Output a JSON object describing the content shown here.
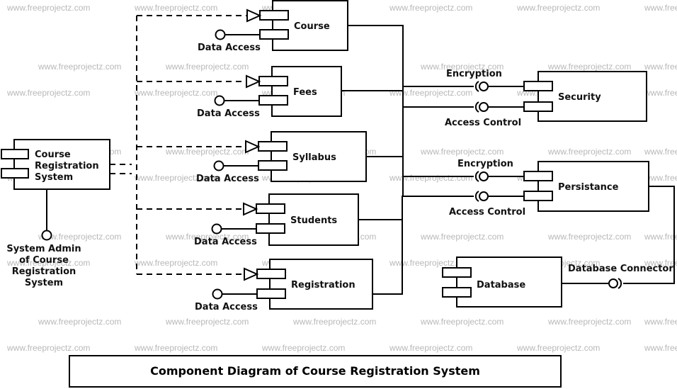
{
  "watermark": "www.freeprojectz.com",
  "title": "Component Diagram of Course Registration System",
  "main_component": {
    "label_lines": [
      "Course",
      "Registration",
      "System"
    ],
    "interface_lines": [
      "System Admin",
      "of Course",
      "Registration",
      "System"
    ]
  },
  "modules": [
    {
      "name": "Course",
      "interface": "Data Access"
    },
    {
      "name": "Fees",
      "interface": "Data Access"
    },
    {
      "name": "Syllabus",
      "interface": "Data Access"
    },
    {
      "name": "Students",
      "interface": "Data Access"
    },
    {
      "name": "Registration",
      "interface": "Data Access"
    }
  ],
  "services": [
    {
      "name": "Security",
      "interfaces": [
        "Encryption",
        "Access Control"
      ]
    },
    {
      "name": "Persistance",
      "interfaces": [
        "Encryption",
        "Access Control"
      ]
    }
  ],
  "database": {
    "name": "Database",
    "interface": "Database Connector"
  }
}
